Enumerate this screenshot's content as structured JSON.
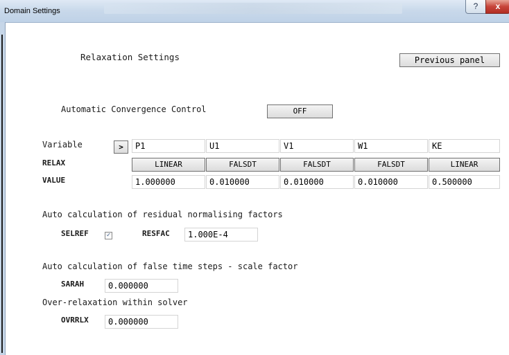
{
  "window": {
    "title": "Domain Settings",
    "help_glyph": "?",
    "close_glyph": "x"
  },
  "header": {
    "title": "Relaxation Settings",
    "previous_panel_label": "Previous panel"
  },
  "convergence": {
    "label": "Automatic Convergence Control",
    "toggle_value": "OFF"
  },
  "table": {
    "variable_label": "Variable",
    "expand_glyph": ">",
    "relax_label": "RELAX",
    "value_label": "VALUE",
    "columns": [
      {
        "variable": "P1",
        "relax": "LINEAR",
        "value": "1.000000"
      },
      {
        "variable": "U1",
        "relax": "FALSDT",
        "value": "0.010000"
      },
      {
        "variable": "V1",
        "relax": "FALSDT",
        "value": "0.010000"
      },
      {
        "variable": "W1",
        "relax": "FALSDT",
        "value": "0.010000"
      },
      {
        "variable": "KE",
        "relax": "LINEAR",
        "value": "0.500000"
      }
    ]
  },
  "residual": {
    "heading": "Auto calculation of residual normalising factors",
    "selref_label": "SELREF",
    "selref_checked": true,
    "resfac_label": "RESFAC",
    "resfac_value": "1.000E-4"
  },
  "false_time": {
    "heading": "Auto calculation of false time steps - scale factor",
    "sarah_label": "SARAH",
    "sarah_value": "0.000000"
  },
  "over_relaxation": {
    "heading": "Over-relaxation within solver",
    "ovrrlx_label": "OVRRLX",
    "ovrrlx_value": "0.000000"
  }
}
